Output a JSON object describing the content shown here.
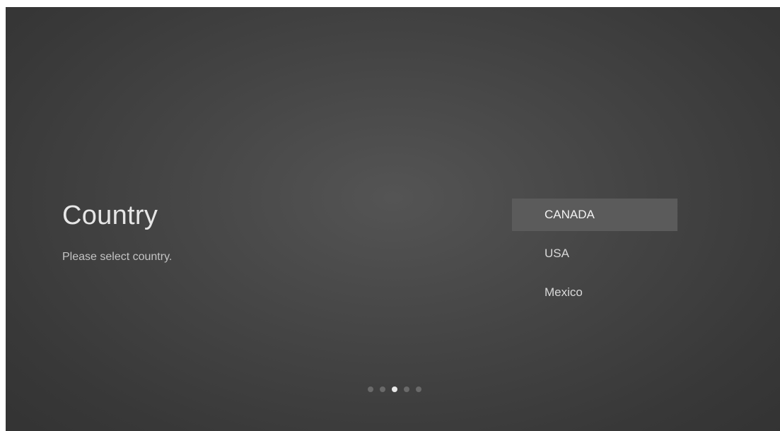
{
  "setup": {
    "title": "Country",
    "subtitle": "Please select country.",
    "countries": [
      {
        "label": "CANADA",
        "selected": true
      },
      {
        "label": "USA",
        "selected": false
      },
      {
        "label": "Mexico",
        "selected": false
      }
    ],
    "pager": {
      "total_steps": 5,
      "current_step": 3
    }
  },
  "colors": {
    "background": "#444444",
    "selected_highlight": "#5b5b5b",
    "text_primary": "#e6e6e6",
    "dot_inactive": "#6a6a6a",
    "dot_active": "#e8e8e8"
  }
}
